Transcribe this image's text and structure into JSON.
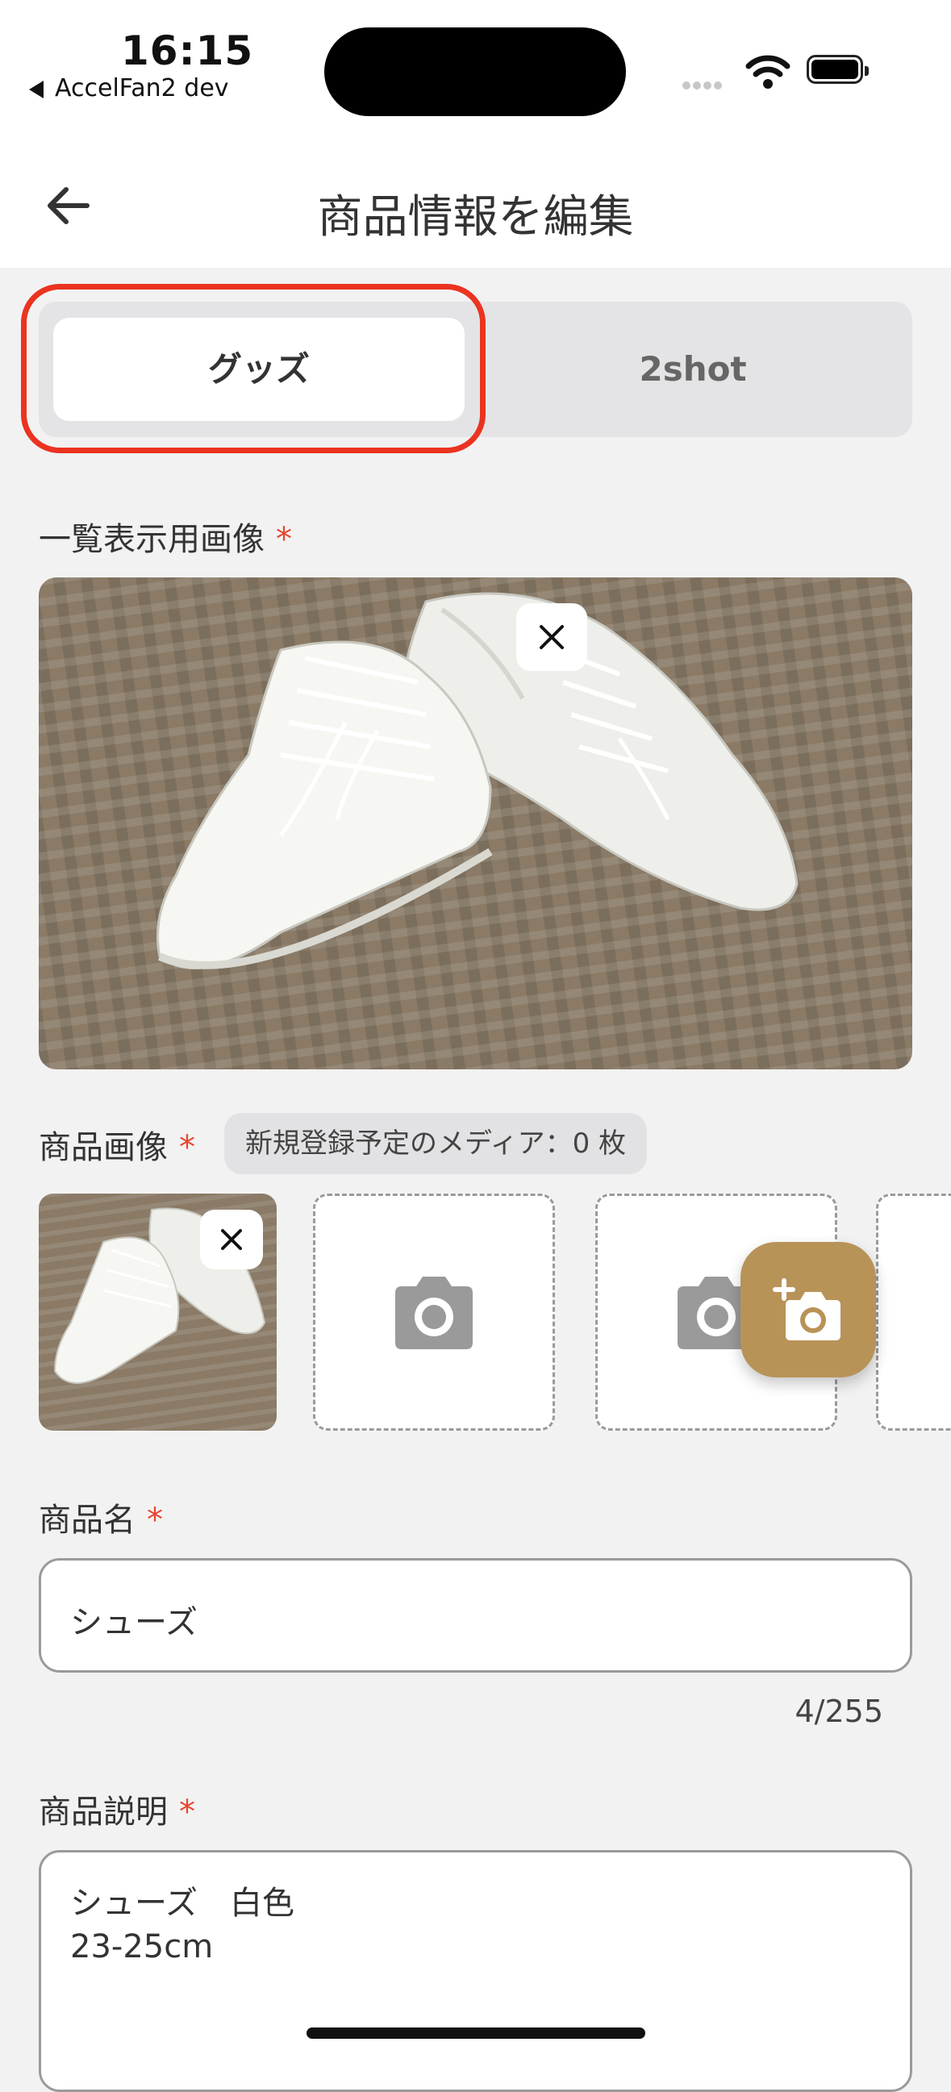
{
  "status_bar": {
    "time": "16:15",
    "back_app_label": "AccelFan2 dev"
  },
  "header": {
    "title": "商品情報を編集"
  },
  "segment": {
    "options": [
      "グッズ",
      "2shot"
    ],
    "selected": "グッズ"
  },
  "list_image": {
    "label": "一覧表示用画像",
    "required_mark": "*"
  },
  "product_images": {
    "label": "商品画像",
    "required_mark": "*",
    "badge": "新規登録予定のメディア：0 枚"
  },
  "product_name": {
    "label": "商品名",
    "required_mark": "*",
    "value": "シューズ",
    "counter": "4/255"
  },
  "product_description": {
    "label": "商品説明",
    "required_mark": "*",
    "line1": "シューズ　白色",
    "line2": "23-25cm"
  },
  "colors": {
    "accent": "#b89358",
    "highlight": "#ea3320",
    "required": "#e8452e"
  }
}
